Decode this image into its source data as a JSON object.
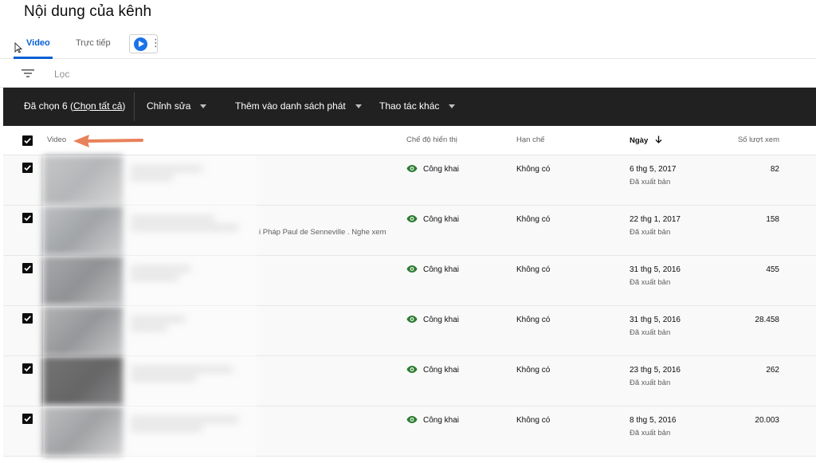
{
  "page_title": "Nội dung của kênh",
  "tabs": [
    {
      "label": "Video",
      "active": true
    },
    {
      "label": "Trực tiếp",
      "active": false
    }
  ],
  "filter": {
    "placeholder": "Lọc"
  },
  "action_bar": {
    "selected_prefix": "Đã chọn 6 (",
    "select_all": "Chọn tất cả",
    "selected_suffix": ")",
    "edit": "Chỉnh sửa",
    "add_to_playlist": "Thêm vào danh sách phát",
    "more_actions": "Thao tác khác"
  },
  "columns": {
    "video": "Video",
    "visibility": "Chế độ hiển thị",
    "restrictions": "Hạn chế",
    "date": "Ngày",
    "views": "Số lượt xem"
  },
  "rows": [
    {
      "visibility": "Công khai",
      "restrictions": "Không có",
      "date": "6 thg 5, 2017",
      "status": "Đã xuất bản",
      "views": "82",
      "description": ""
    },
    {
      "visibility": "Công khai",
      "restrictions": "Không có",
      "date": "22 thg 1, 2017",
      "status": "Đã xuất bản",
      "views": "158",
      "description": "i Pháp Paul de Senneville . Nghe xem"
    },
    {
      "visibility": "Công khai",
      "restrictions": "Không có",
      "date": "31 thg 5, 2016",
      "status": "Đã xuất bản",
      "views": "455",
      "description": ""
    },
    {
      "visibility": "Công khai",
      "restrictions": "Không có",
      "date": "31 thg 5, 2016",
      "status": "Đã xuất bản",
      "views": "28.458",
      "description": ""
    },
    {
      "visibility": "Công khai",
      "restrictions": "Không có",
      "date": "23 thg 5, 2016",
      "status": "Đã xuất bản",
      "views": "262",
      "description": ""
    },
    {
      "visibility": "Công khai",
      "restrictions": "Không có",
      "date": "8 thg 5, 2016",
      "status": "Đã xuất bản",
      "views": "20.003",
      "description": ""
    }
  ],
  "colors": {
    "accent": "#065fd4",
    "action_bar": "#212121",
    "visibility_icon": "#2e7d32",
    "annotation_arrow": "#e8825a"
  },
  "icons": [
    "filter-icon",
    "arrow-down-sort-icon",
    "eye-icon",
    "checkbox-checked-icon",
    "caret-down-icon",
    "extension-logo-icon",
    "more-vert-icon"
  ]
}
